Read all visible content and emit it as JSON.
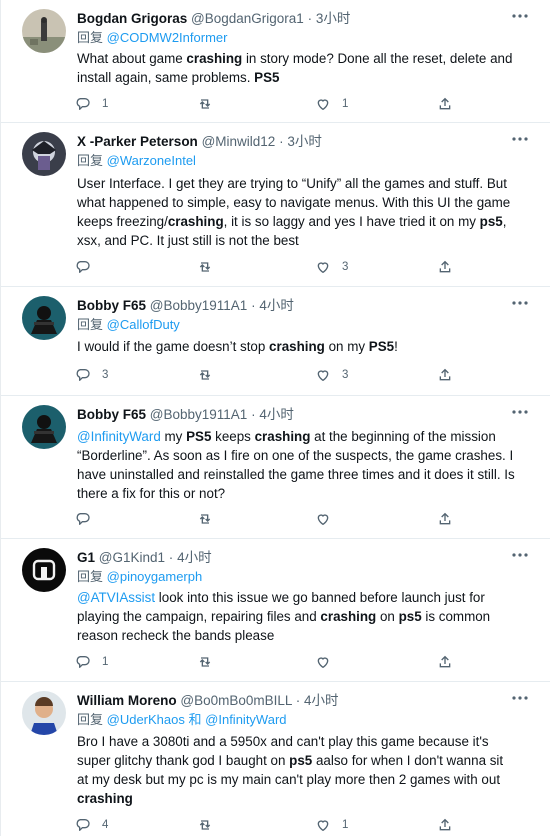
{
  "reply_prefix": "回复",
  "tweets": [
    {
      "name": "Bogdan Grigoras",
      "handle": "@BogdanGrigora1",
      "time": "3小时",
      "reply_to": "@CODMW2Informer",
      "text_parts": [
        "What about game ",
        "crashing",
        " in story mode? Done all the reset, delete and install again, same problems. ",
        "PS5"
      ],
      "replies": "1",
      "retweets": "",
      "likes": "1"
    },
    {
      "name": "X -Parker Peterson",
      "handle": "@Minwild12",
      "time": "3小时",
      "reply_to": "@WarzoneIntel",
      "text_parts": [
        "User Interface. I get they are trying to “Unify” all the games and stuff. But what happened to simple, easy to navigate menus. With this UI the game keeps freezing/",
        "crashing",
        ", it is so laggy and yes I have tried it on my ",
        "ps5",
        ", xsx, and PC. It just still is not the best"
      ],
      "replies": "",
      "retweets": "",
      "likes": "3"
    },
    {
      "name": "Bobby F65",
      "handle": "@Bobby1911A1",
      "time": "4小时",
      "reply_to": "@CallofDuty",
      "text_parts": [
        "I would if the game doesn’t stop ",
        "crashing",
        " on my ",
        "PS5",
        "!"
      ],
      "replies": "3",
      "retweets": "",
      "likes": "3"
    },
    {
      "name": "Bobby F65",
      "handle": "@Bobby1911A1",
      "time": "4小时",
      "mention": "@InfinityWard",
      "text_parts": [
        " my ",
        "PS5",
        " keeps ",
        "crashing",
        " at the beginning of the mission “Borderline”. As soon as I fire on one of the suspects, the game crashes. I have uninstalled and reinstalled the game three times and it does it still. Is there a fix for this or not?"
      ],
      "replies": "",
      "retweets": "",
      "likes": ""
    },
    {
      "name": "G1",
      "handle": "@G1Kind1",
      "time": "4小时",
      "reply_to": "@pinoygamerph",
      "mention": "@ATVIAssist",
      "text_parts": [
        " look into this issue we go banned before launch just for playing the campaign, repairing files and ",
        "crashing",
        " on ",
        "ps5",
        " is common reason recheck the bands please"
      ],
      "replies": "1",
      "retweets": "",
      "likes": ""
    },
    {
      "name": "William Moreno",
      "handle": "@Bo0mBo0mBILL",
      "time": "4小时",
      "reply_to": "@UderKhaos",
      "reply_and": "和",
      "reply_to2": "@InfinityWard",
      "text_parts": [
        "Bro I have a 3080ti and a 5950x and can't play this game because it's super glitchy thank god I baught on ",
        "ps5",
        " aalso for when I don't wanna sit at my desk but my pc is my main can't play more then 2 games with out ",
        "crashing"
      ],
      "replies": "4",
      "retweets": "",
      "likes": "1"
    }
  ]
}
